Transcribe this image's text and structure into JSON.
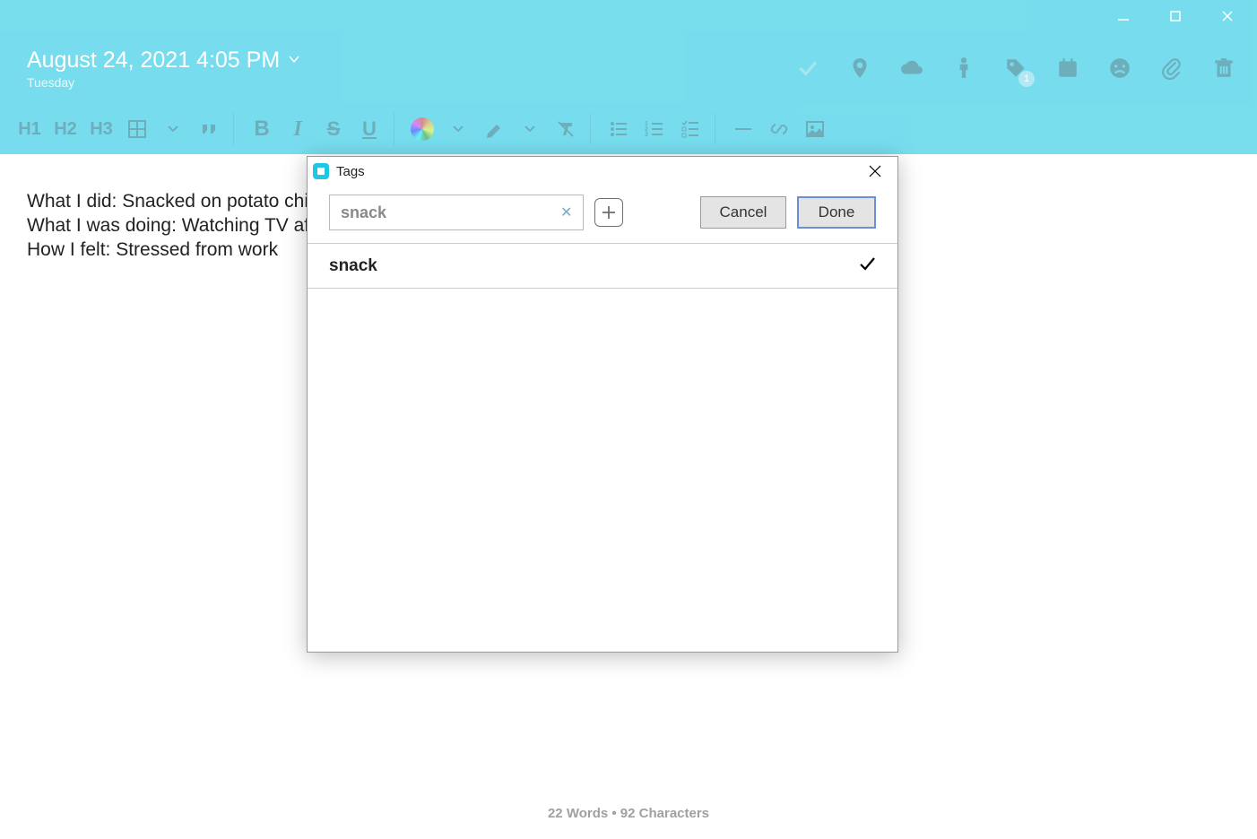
{
  "window": {
    "minimize": "—",
    "maximize": "",
    "close": ""
  },
  "header": {
    "date": "August 24, 2021 4:05 PM",
    "day": "Tuesday",
    "tag_badge": "1"
  },
  "toolbar": {
    "h1": "H1",
    "h2": "H2",
    "h3": "H3"
  },
  "editor": {
    "line1": "What I did: Snacked on potato chips t",
    "line2": "What I was doing: Watching TV after ",
    "line3": "How I felt: Stressed from work"
  },
  "statusbar": {
    "text": "22 Words • 92 Characters"
  },
  "modal": {
    "title": "Tags",
    "input_value": "snack",
    "cancel": "Cancel",
    "done": "Done",
    "tags": [
      {
        "label": "snack",
        "selected": true
      }
    ]
  }
}
